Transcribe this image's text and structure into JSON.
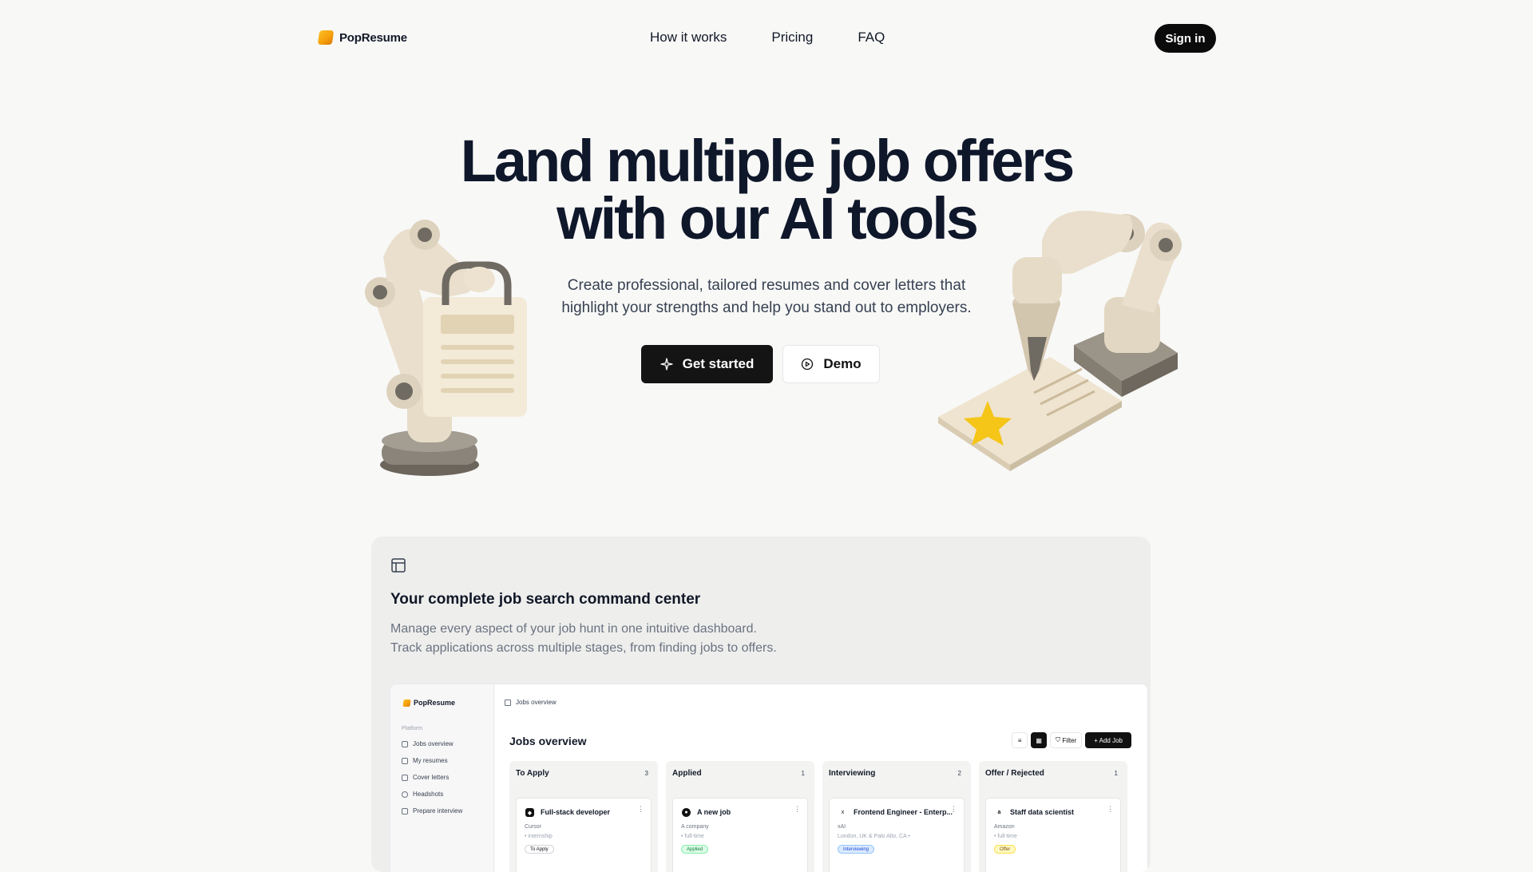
{
  "nav": {
    "brand": "PopResume",
    "links": [
      "How it works",
      "Pricing",
      "FAQ"
    ],
    "signin": "Sign in"
  },
  "hero": {
    "title_line1": "Land multiple job offers",
    "title_line2": "with our AI tools",
    "subtitle_line1": "Create professional, tailored resumes and cover letters that",
    "subtitle_line2": "highlight your strengths and help you stand out to employers.",
    "primary_cta": "Get started",
    "secondary_cta": "Demo"
  },
  "feature": {
    "title": "Your complete job search command center",
    "desc_line1": "Manage every aspect of your job hunt in one intuitive dashboard.",
    "desc_line2": "Track applications across multiple stages, from finding jobs to offers."
  },
  "dashboard": {
    "brand": "PopResume",
    "section": "Platform",
    "nav": [
      "Jobs overview",
      "My resumes",
      "Cover letters",
      "Headshots",
      "Prepare interview"
    ],
    "breadcrumb": "Jobs overview",
    "title": "Jobs overview",
    "filter": "Filter",
    "add_job": "+ Add Job",
    "columns": [
      {
        "name": "To Apply",
        "count": "3",
        "job": {
          "title": "Full-stack developer",
          "company": "Cursor",
          "type": "• internship",
          "status": "To Apply"
        }
      },
      {
        "name": "Applied",
        "count": "1",
        "job": {
          "title": "A new job",
          "company": "A company",
          "type": "• full-time",
          "status": "Applied"
        }
      },
      {
        "name": "Interviewing",
        "count": "2",
        "job": {
          "title": "Frontend Engineer - Enterp...",
          "company": "xAI",
          "type": "London, UK & Palo Alto, CA •",
          "status": "Interviewing"
        }
      },
      {
        "name": "Offer / Rejected",
        "count": "1",
        "job": {
          "title": "Staff data scientist",
          "company": "Amazon",
          "type": "• full-time",
          "status": "Offer"
        }
      }
    ]
  }
}
